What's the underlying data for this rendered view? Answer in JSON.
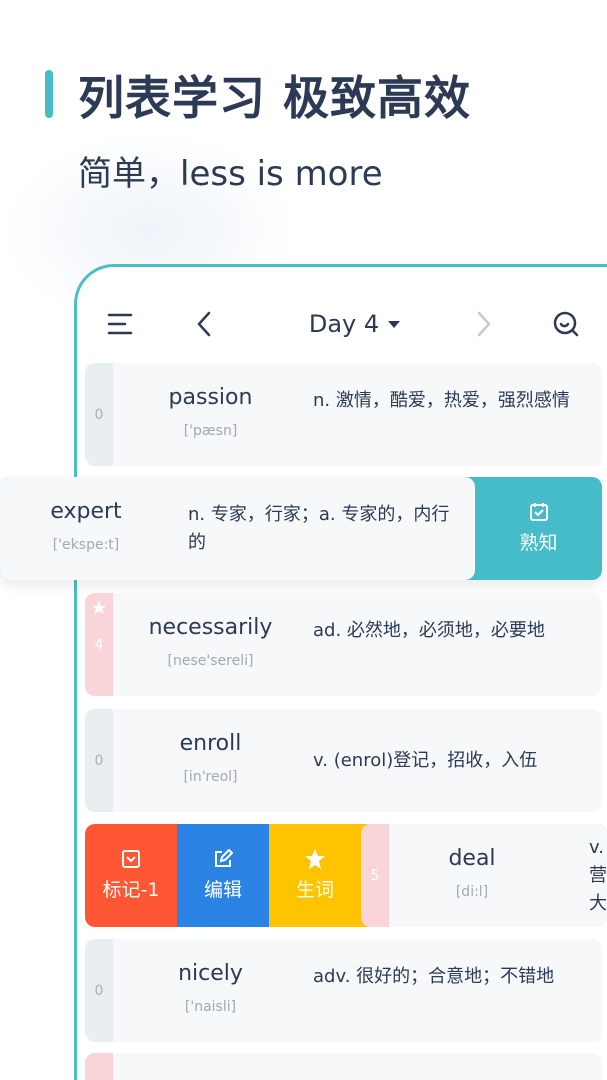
{
  "header": {
    "title": "列表学习 极致高效",
    "subtitle": "简单，less is more"
  },
  "toolbar": {
    "day_label": "Day 4"
  },
  "rows": [
    {
      "count": "0",
      "word": "passion",
      "phonetic": "['pæsn]",
      "definition": "n. 激情，酷爱，热爱，强烈感情"
    },
    {
      "word": "expert",
      "phonetic": "['ekspe:t]",
      "definition": "n. 专家，行家；a. 专家的，内行的",
      "action": "熟知"
    },
    {
      "count": "4",
      "word": "necessarily",
      "phonetic": "[nese'sereli]",
      "definition": "ad. 必然地，必须地，必要地",
      "starred": true
    },
    {
      "count": "0",
      "word": "enroll",
      "phonetic": "[in'reol]",
      "definition": "v. (enrol)登记，招收，入伍"
    },
    {
      "count": "5",
      "word": "deal",
      "phonetic": "[di:l]",
      "definition": "v. 营 大",
      "actions": [
        "标记-1",
        "编辑",
        "生词"
      ]
    },
    {
      "count": "0",
      "word": "nicely",
      "phonetic": "['naisli]",
      "definition": "adv. 很好的；合意地；不错地"
    }
  ],
  "colors": {
    "accent": "#45bcc8",
    "mark": "#ff5733",
    "edit": "#2b83e3",
    "star": "#ffc300"
  }
}
